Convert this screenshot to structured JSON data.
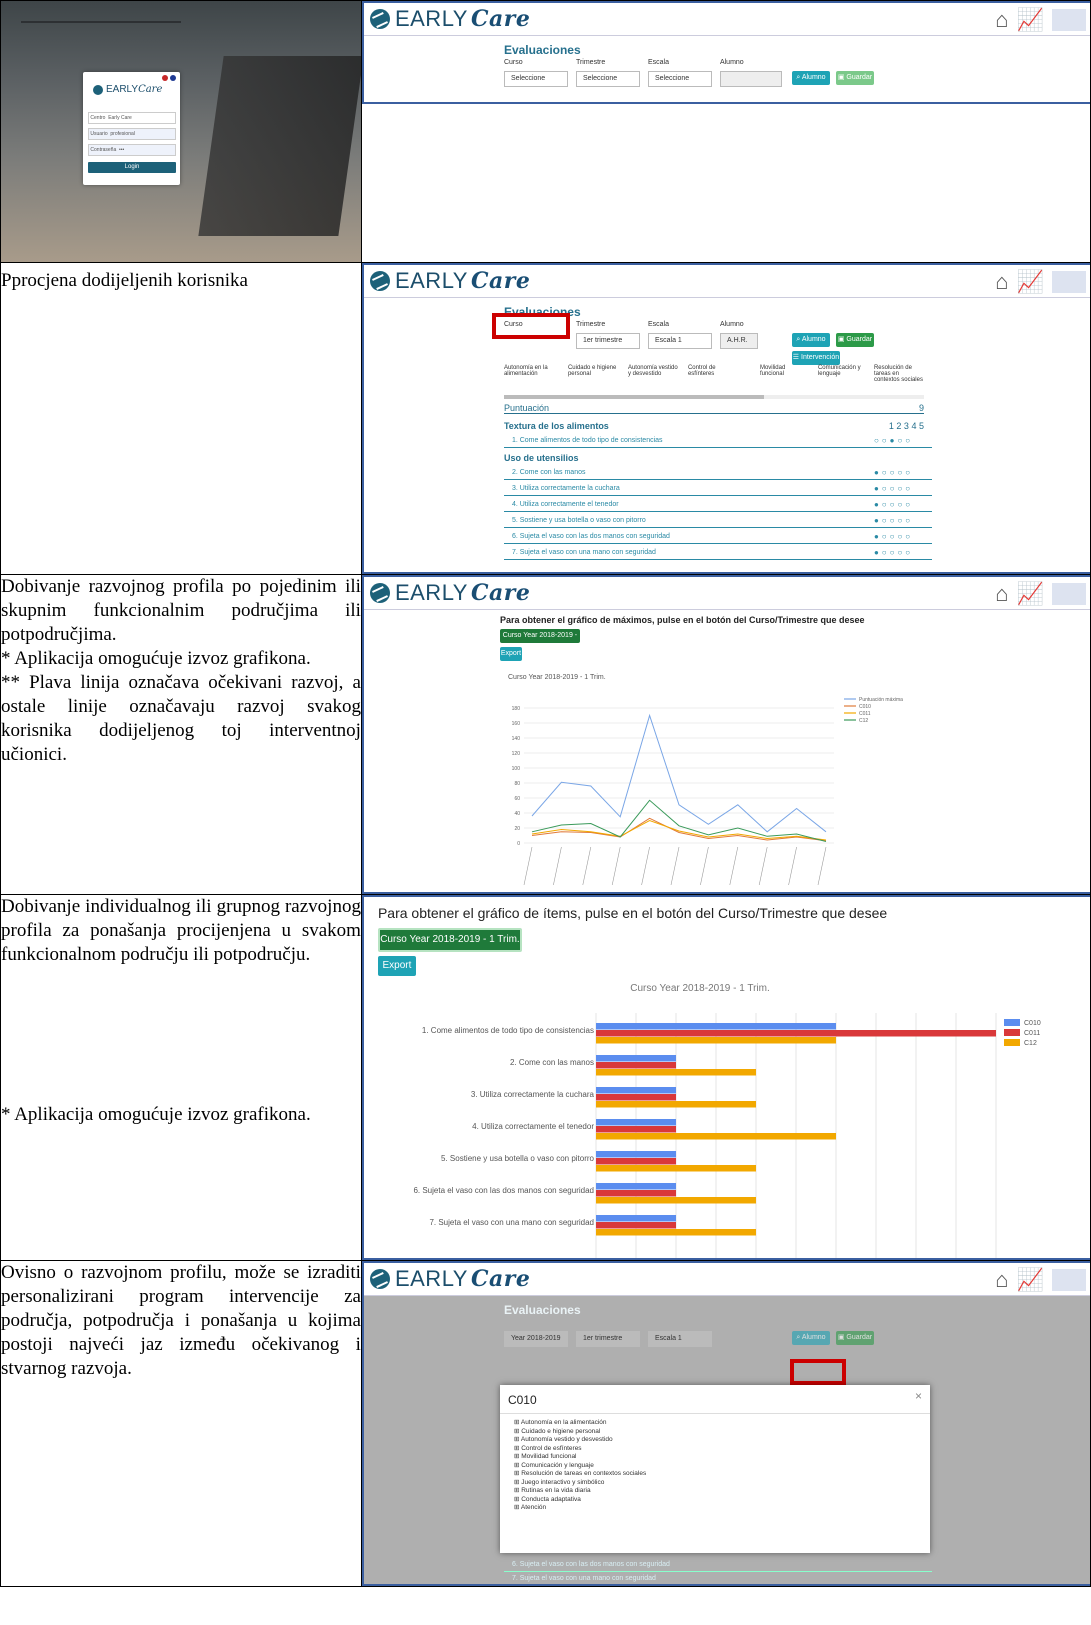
{
  "rows": [
    {
      "text": ""
    },
    {
      "text": "Pprocjena dodijeljenih korisnika"
    },
    {
      "text": "Dobivanje razvojnog profila po pojedinim ili skupnim funkcionalnim područjima ili potpodručjima.\n* Aplikacija omogućuje izvoz grafikona.\n** Plava linija označava očekivani razvoj, a ostale linije označavaju razvoj svakog korisnika dodijeljenog toj interventnoj učionici."
    },
    {
      "text": "Dobivanje individualnog ili grupnog razvojnog profila za ponašanja procijenjena u svakom funkcionalnom području ili potpodručju.",
      "note": "* Aplikacija omogućuje izvoz grafikona."
    },
    {
      "text": "Ovisno o razvojnom profilu, može se izraditi personalizirani program intervencije za područja, potpodručja i ponašanja u kojima postoji najveći jaz između očekivanog i stvarnog razvoja."
    }
  ],
  "app": {
    "brand_early": "EARLY",
    "brand_care": "Care",
    "evaluaciones": "Evaluaciones",
    "lbl_curso": "Curso",
    "lbl_trimestre": "Trimestre",
    "lbl_escala": "Escala",
    "lbl_alumno": "Alumno",
    "seleccione": "Seleccione",
    "btn_alumno": "Alumno",
    "btn_guardar": "Guardar",
    "btn_intervencion": "Intervención",
    "year_sel": "Year 2018-2019",
    "trim_sel": "1er trimestre",
    "escala_sel": "Escala 1",
    "alumno_val": "A.H.R.",
    "tabs": [
      "Autonomía en la alimentación",
      "Cuidado e higiene personal",
      "Autonomía vestido y desvestido",
      "Control de esfínteres",
      "Movilidad funcional",
      "Comunicación y lenguaje",
      "Resolución de tareas en contextos sociales"
    ],
    "puntuacion": "Puntuación",
    "puntuacion_val": "9",
    "textura": "Textura de los alimentos",
    "scale": "1  2  3  4  5",
    "uso": "Uso de utensilios",
    "items": [
      "1. Come alimentos de todo tipo de consistencias",
      "2. Come con las manos",
      "3. Utiliza correctamente la cuchara",
      "4. Utiliza correctamente el tenedor",
      "5. Sostiene y usa botella o vaso con pitorro",
      "6. Sujeta el vaso con las dos manos con seguridad",
      "7. Sujeta el vaso con una mano con seguridad"
    ],
    "login_field1": "Centro",
    "login_val1": "Early Care",
    "login_field2": "Usuario",
    "login_val2": "profesional",
    "login_field3": "Contraseña",
    "login_val3": "•••",
    "login_btn": "Login"
  },
  "line_panel": {
    "heading": "Para obtener el gráfico de máximos, pulse en el botón del Curso/Trimestre que desee",
    "button": "Curso Year 2018-2019 - 1 Trim.",
    "export": "Export",
    "title": "Curso Year 2018-2019 - 1 Trim.",
    "legend": [
      "Puntuación máxima",
      "C010",
      "C011",
      "C12"
    ]
  },
  "bar_panel": {
    "heading": "Para obtener el gráfico de ítems, pulse en el botón del Curso/Trimestre que desee",
    "button": "Curso Year 2018-2019 - 1 Trim.",
    "export": "Export",
    "title": "Curso Year 2018-2019 - 1 Trim."
  },
  "modal": {
    "title": "C010",
    "close": "×",
    "tree": [
      "Autonomía en la alimentación",
      "Cuidado e higiene personal",
      "Autonomía vestido y desvestido",
      "Control de esfínteres",
      "Movilidad funcional",
      "Comunicación y lenguaje",
      "Resolución de tareas en contextos sociales",
      "Juego interactivo y simbólico",
      "Rutinas en la vida diaria",
      "Conducta adaptativa",
      "Atención"
    ]
  },
  "colors": {
    "blue": "#5b8def",
    "red": "#d9383a",
    "orange": "#f2a800",
    "green": "#3a9a5a",
    "teal": "#1ea3b5"
  },
  "chart_data": [
    {
      "type": "line",
      "title": "Curso Year 2018-2019 - 1 Trim.",
      "categories": [
        "c1",
        "c2",
        "c3",
        "c4",
        "c5",
        "c6",
        "c7",
        "c8",
        "c9",
        "c10",
        "c11",
        "c12"
      ],
      "ylim": [
        0,
        200
      ],
      "yticks": [
        0,
        20,
        40,
        60,
        80,
        100,
        120,
        140,
        160,
        180
      ],
      "series": [
        {
          "name": "Puntuación máxima",
          "color": "#7aa6e6",
          "values": [
            36,
            81,
            76,
            35,
            170,
            51,
            25,
            51,
            15,
            46,
            15
          ]
        },
        {
          "name": "C010",
          "color": "#e07a3a",
          "values": [
            10,
            15,
            14,
            8,
            33,
            14,
            6,
            10,
            4,
            8,
            3
          ]
        },
        {
          "name": "C011",
          "color": "#f2a800",
          "values": [
            12,
            18,
            15,
            9,
            30,
            16,
            8,
            12,
            6,
            9,
            4
          ]
        },
        {
          "name": "C12",
          "color": "#3a9a5a",
          "values": [
            15,
            24,
            26,
            8,
            57,
            23,
            11,
            20,
            9,
            12,
            2
          ]
        }
      ],
      "legend": "right"
    },
    {
      "type": "bar",
      "orientation": "horizontal",
      "title": "Curso Year 2018-2019 - 1 Trim.",
      "categories": [
        "1. Come alimentos de todo tipo de consistencias",
        "2. Come con las manos",
        "3. Utiliza correctamente la cuchara",
        "4. Utiliza correctamente el tenedor",
        "5. Sostiene y usa botella o vaso con pitorro",
        "6. Sujeta el vaso con las dos manos con seguridad",
        "7. Sujeta el vaso con una mano con seguridad"
      ],
      "series": [
        {
          "name": "C010",
          "color": "#5b8def",
          "values": [
            3,
            1,
            1,
            1,
            1,
            1,
            1
          ]
        },
        {
          "name": "C011",
          "color": "#d9383a",
          "values": [
            5,
            1,
            1,
            1,
            1,
            1,
            1
          ]
        },
        {
          "name": "C12",
          "color": "#f2a800",
          "values": [
            3,
            2,
            2,
            3,
            2,
            2,
            2
          ]
        }
      ],
      "xlim": [
        0,
        5
      ],
      "legend": "right"
    }
  ]
}
